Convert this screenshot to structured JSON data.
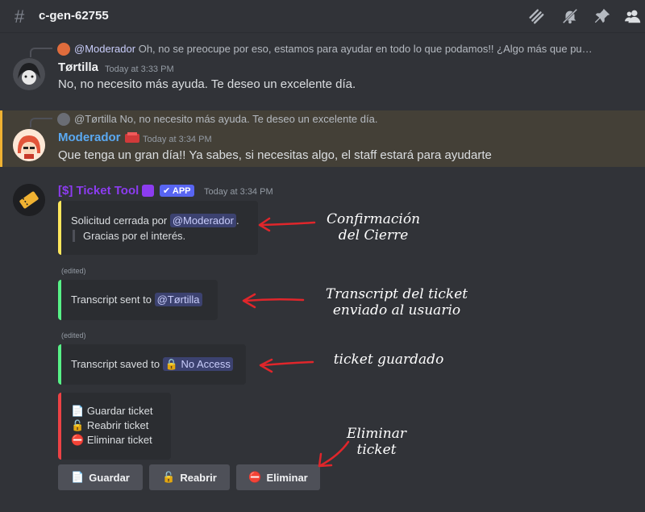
{
  "header": {
    "channel": "c-gen-62755",
    "icons": [
      "threads-icon",
      "mute-bell-icon",
      "pin-icon",
      "members-icon"
    ]
  },
  "messages": [
    {
      "reply": {
        "author": "@Moderador",
        "text": "Oh, no se preocupe por eso, estamos para ayudar en todo lo que podamos!! ¿Algo más que pu…"
      },
      "author": "Tørtilla",
      "timestamp": "Today at 3:33 PM",
      "text": "No, no necesito más ayuda. Te deseo un excelente día."
    },
    {
      "reply": {
        "author": "@Tørtilla",
        "text": "No, no necesito más ayuda. Te deseo un excelente día."
      },
      "author": "Moderador",
      "timestamp": "Today at 3:34 PM",
      "text": "Que tenga un gran día!! Ya sabes, si necesitas algo, el staff estará para ayudarte",
      "author_color": "#5aa9f2"
    },
    {
      "author": "[$] Ticket Tool",
      "badge": "APP",
      "timestamp": "Today at 3:34 PM",
      "author_color": "#8c3cf0"
    }
  ],
  "embeds": {
    "closed": {
      "text": "Solicitud cerrada por",
      "mention": "@Moderador",
      "suffix": ".",
      "quote": "Gracias por el interés.",
      "color": "#fee75c"
    },
    "edited_label": "(edited)",
    "transcript_sent": {
      "text": "Transcript sent to",
      "mention": "@Tørtilla",
      "color": "#57f287"
    },
    "transcript_saved": {
      "text": "Transcript saved to",
      "mention": "No Access",
      "color": "#57f287"
    },
    "controls": {
      "items": [
        "Guardar ticket",
        "Reabrir ticket",
        "Eliminar ticket"
      ],
      "color": "#ed4245"
    }
  },
  "buttons": [
    {
      "label": "Guardar",
      "icon": "document-icon"
    },
    {
      "label": "Reabrir",
      "icon": "unlock-icon"
    },
    {
      "label": "Eliminar",
      "icon": "no-entry-icon"
    }
  ],
  "annotations": {
    "closed": "Confirmación\ndel Cierre",
    "sent": "Transcript del ticket\nenviado al usuario",
    "saved": "ticket guardado",
    "delete": "Eliminar\nticket"
  }
}
